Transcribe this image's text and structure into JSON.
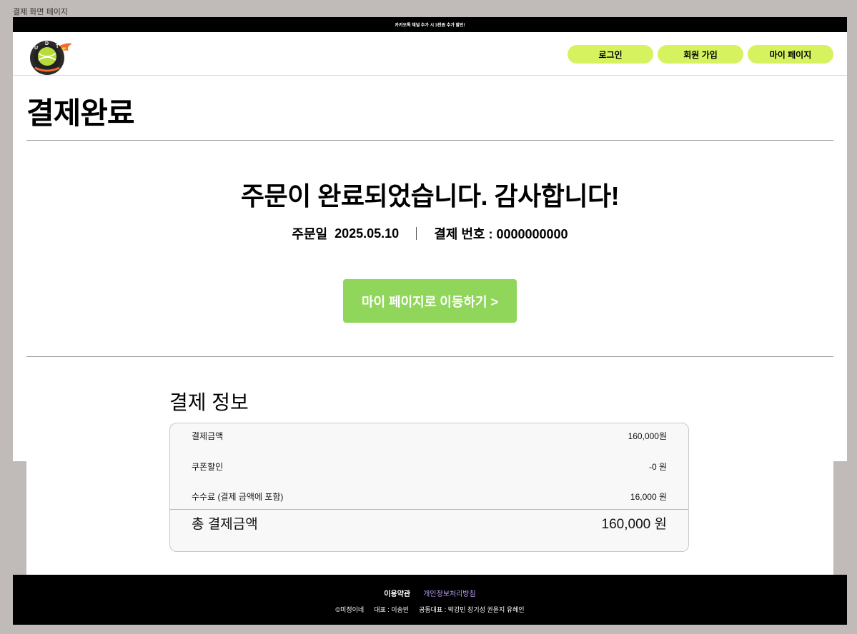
{
  "frame_title": "결제 화면 페이지",
  "promo_bar": {
    "text": "카카오톡 채널 추가 시 3천원 추가 할인!"
  },
  "header": {
    "logo_letters": [
      "U",
      "D",
      "T"
    ],
    "nav": {
      "login": "로그인",
      "signup": "회원 가입",
      "mypage": "마이 페이지"
    }
  },
  "colors": {
    "nav_button": "#d6f25f",
    "mypage_button": "#8fd65a",
    "privacy_link": "#b69cf5"
  },
  "main": {
    "title": "결제완료",
    "thanks_message": "주문이 완료되었습니다. 감사합니다!",
    "order_date_label": "주문일",
    "order_date_value": "2025.05.10",
    "payment_number": "결제 번호 : 0000000000",
    "mypage_button": "마이 페이지로 이동하기 >"
  },
  "payment_info": {
    "title": "결제 정보",
    "rows": [
      {
        "label": "결제금액",
        "value": "160,000원"
      },
      {
        "label": "쿠폰할인",
        "value": "-0 원"
      },
      {
        "label": "수수료 (결제 금액에 포함)",
        "value": "16,000 원"
      }
    ],
    "total_label": "총 결제금액",
    "total_value": "160,000 원"
  },
  "footer": {
    "terms": "이용약관",
    "privacy": "개인정보처리방침",
    "copyright": "©미정이네",
    "ceo": "대표 : 이송빈",
    "co_ceo": "공동대표 : 박강민 장기성 권윤지 유혜인"
  }
}
